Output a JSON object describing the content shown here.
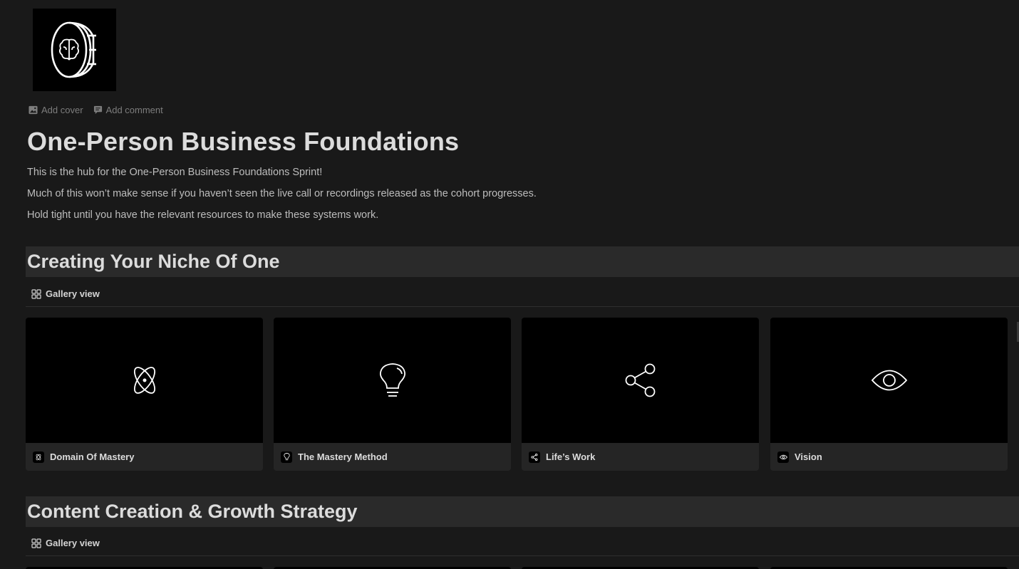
{
  "page": {
    "title": "One-Person Business Foundations",
    "icon": "brain-coin-icon",
    "actions": {
      "add_cover": "Add cover",
      "add_comment": "Add comment"
    },
    "intro": [
      "This is the hub for the One-Person Business Foundations Sprint!",
      "Much of this won’t make sense if you haven’t seen the live call or recordings released as the cohort progresses.",
      "Hold tight until you have the relevant resources to make these systems work."
    ]
  },
  "sections": [
    {
      "title": "Creating Your Niche Of One",
      "view_label": "Gallery view",
      "cards": [
        {
          "title": "Domain Of Mastery",
          "icon": "atom-icon"
        },
        {
          "title": "The Mastery Method",
          "icon": "lightbulb-icon"
        },
        {
          "title": "Life’s Work",
          "icon": "share-icon"
        },
        {
          "title": "Vision",
          "icon": "eye-icon"
        }
      ]
    },
    {
      "title": "Content Creation & Growth Strategy",
      "view_label": "Gallery view"
    }
  ],
  "colors": {
    "background": "#191919",
    "section_header": "#2a2a2a",
    "card": "#252525",
    "cover": "#000000",
    "text": "#dcdcdc",
    "muted": "#7d7d7d"
  }
}
